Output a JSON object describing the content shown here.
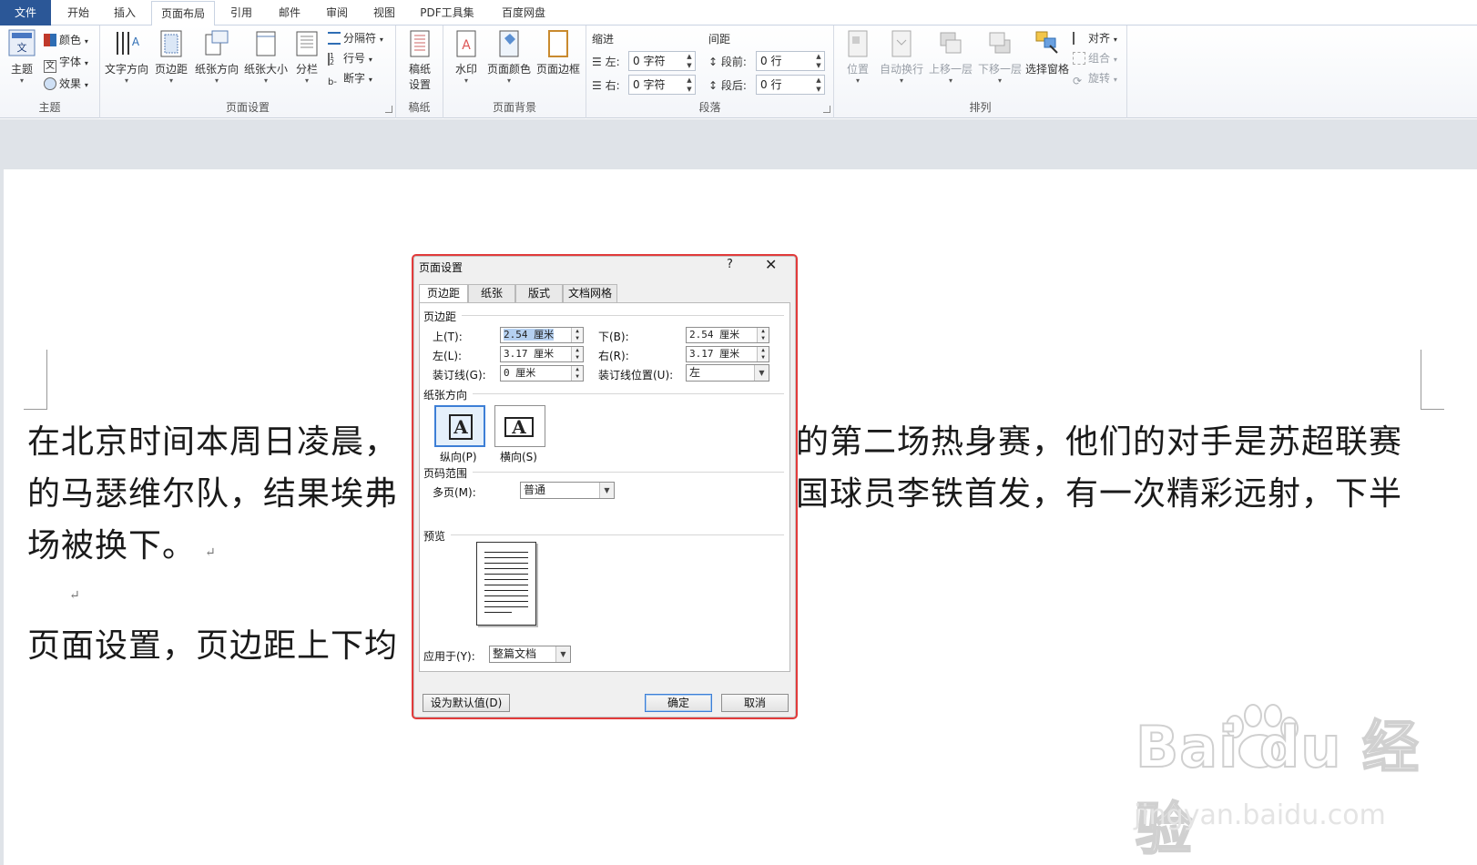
{
  "ribbon_tabs": [
    {
      "label": "文件",
      "kind": "file"
    },
    {
      "label": "开始",
      "kind": ""
    },
    {
      "label": "插入",
      "kind": ""
    },
    {
      "label": "页面布局",
      "kind": "active"
    },
    {
      "label": "引用",
      "kind": ""
    },
    {
      "label": "邮件",
      "kind": ""
    },
    {
      "label": "审阅",
      "kind": ""
    },
    {
      "label": "视图",
      "kind": ""
    },
    {
      "label": "PDF工具集",
      "kind": ""
    },
    {
      "label": "百度网盘",
      "kind": ""
    }
  ],
  "ribbon": {
    "theme_group": {
      "label": "主题",
      "theme_button": "主题",
      "colors": "颜色",
      "fonts": "字体",
      "effects": "效果"
    },
    "page_setup_group": {
      "label": "页面设置",
      "text_direction": "文字方向",
      "margins": "页边距",
      "orientation": "纸张方向",
      "size": "纸张大小",
      "columns": "分栏",
      "breaks": "分隔符",
      "line_numbers": "行号",
      "hyphenation": "断字"
    },
    "manuscript_group": {
      "label": "稿纸",
      "setup_line1": "稿纸",
      "setup_line2": "设置"
    },
    "page_background_group": {
      "label": "页面背景",
      "watermark": "水印",
      "page_color": "页面颜色",
      "page_borders": "页面边框"
    },
    "paragraph_group": {
      "label": "段落",
      "indent_title": "缩进",
      "spacing_title": "间距",
      "indent_left_label": "左:",
      "indent_left_value": "0 字符",
      "indent_right_label": "右:",
      "indent_right_value": "0 字符",
      "spacing_before_label": "段前:",
      "spacing_before_value": "0 行",
      "spacing_after_label": "段后:",
      "spacing_after_value": "0 行"
    },
    "arrange_group": {
      "label": "排列",
      "position": "位置",
      "wrap_text": "自动换行",
      "bring_forward": "上移一层",
      "send_backward": "下移一层",
      "selection_pane": "选择窗格",
      "align": "对齐",
      "group": "组合",
      "rotate": "旋转"
    }
  },
  "document": {
    "line1_a": "在北京时间本周日凌晨，",
    "line1_b": "的第二场热身赛，他们的对手是苏超联赛",
    "line2_a": "的马瑟维尔队，结果埃弗",
    "line2_b": "国球员李铁首发，有一次精彩远射，下半",
    "line3": "场被换下。",
    "line4": "页面设置，页边距上下均",
    "para_mark": "↵"
  },
  "dialog": {
    "title": "页面设置",
    "help": "?",
    "close": "✕",
    "tabs": [
      "页边距",
      "纸张",
      "版式",
      "文档网格"
    ],
    "margins_section": "页边距",
    "top_label": "上(T):",
    "top_value_num": "2.54",
    "top_value_unit": " 厘米",
    "bottom_label": "下(B):",
    "bottom_value": "2.54 厘米",
    "left_label": "左(L):",
    "left_value": "3.17 厘米",
    "right_label": "右(R):",
    "right_value": "3.17 厘米",
    "gutter_label": "装订线(G):",
    "gutter_value": "0 厘米",
    "gutter_pos_label": "装订线位置(U):",
    "gutter_pos_value": "左",
    "orientation_section": "纸张方向",
    "portrait": "纵向(P)",
    "landscape": "横向(S)",
    "orientation_glyph": "A",
    "pages_section": "页码范围",
    "multiple_pages_label": "多页(M):",
    "multiple_pages_value": "普通",
    "preview_section": "预览",
    "apply_to_label": "应用于(Y):",
    "apply_to_value": "整篇文档",
    "set_default": "设为默认值(D)",
    "ok": "确定",
    "cancel": "取消"
  },
  "watermark": {
    "logo": "Bai du 经验",
    "url": "jingyan.baidu.com"
  },
  "colors": {
    "file_tab": "#2b5797",
    "dialog_highlight": "#e23b3b",
    "selection": "#b5d0f0"
  }
}
